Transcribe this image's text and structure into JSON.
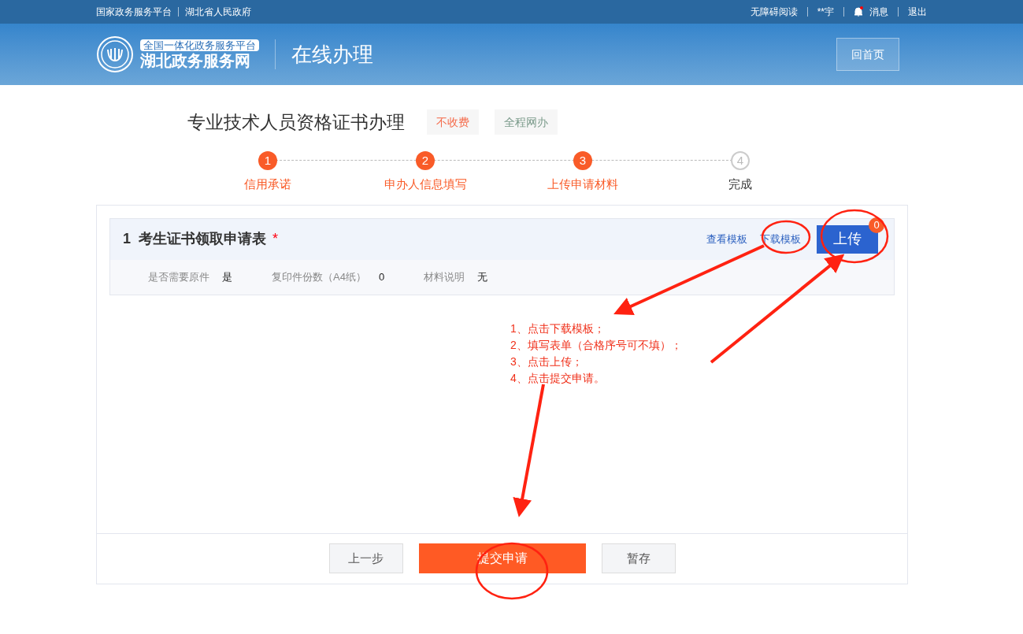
{
  "top_bar": {
    "left_links": [
      "国家政务服务平台",
      "湖北省人民政府"
    ],
    "right_links": [
      "无障碍阅读",
      "**宇",
      "消息",
      "退出"
    ],
    "has_unread": true
  },
  "header": {
    "logo_tag": "全国一体化政务服务平台",
    "logo_name": "湖北政务服务网",
    "section": "在线办理",
    "home_button": "回首页"
  },
  "title": "专业技术人员资格证书办理",
  "tags": [
    {
      "label": "不收费",
      "color": "#f56c4c"
    },
    {
      "label": "全程网办",
      "color": "#7a9a8a"
    }
  ],
  "steps": [
    {
      "number": "1",
      "label": "信用承诺",
      "done": true
    },
    {
      "number": "2",
      "label": "申办人信息填写",
      "done": true
    },
    {
      "number": "3",
      "label": "上传申请材料",
      "done": true
    },
    {
      "number": "4",
      "label": "完成",
      "done": false
    }
  ],
  "material": {
    "index": "1",
    "name": "考生证书领取申请表",
    "required_mark": "*",
    "view_link": "查看模板",
    "download_link": "下载模板",
    "upload_button": "上传",
    "upload_count": "0",
    "fields": [
      {
        "label": "是否需要原件",
        "value": "是"
      },
      {
        "label": "复印件份数（A4纸）",
        "value": "0"
      },
      {
        "label": "材料说明",
        "value": "无"
      }
    ]
  },
  "annotation": [
    "1、点击下载模板；",
    "2、填写表单（合格序号可不填）；",
    "3、点击上传；",
    "4、点击提交申请。"
  ],
  "buttons": [
    {
      "label": "上一步",
      "kind": "secondary"
    },
    {
      "label": "提交申请",
      "kind": "primary"
    },
    {
      "label": "暂存",
      "kind": "secondary"
    }
  ]
}
